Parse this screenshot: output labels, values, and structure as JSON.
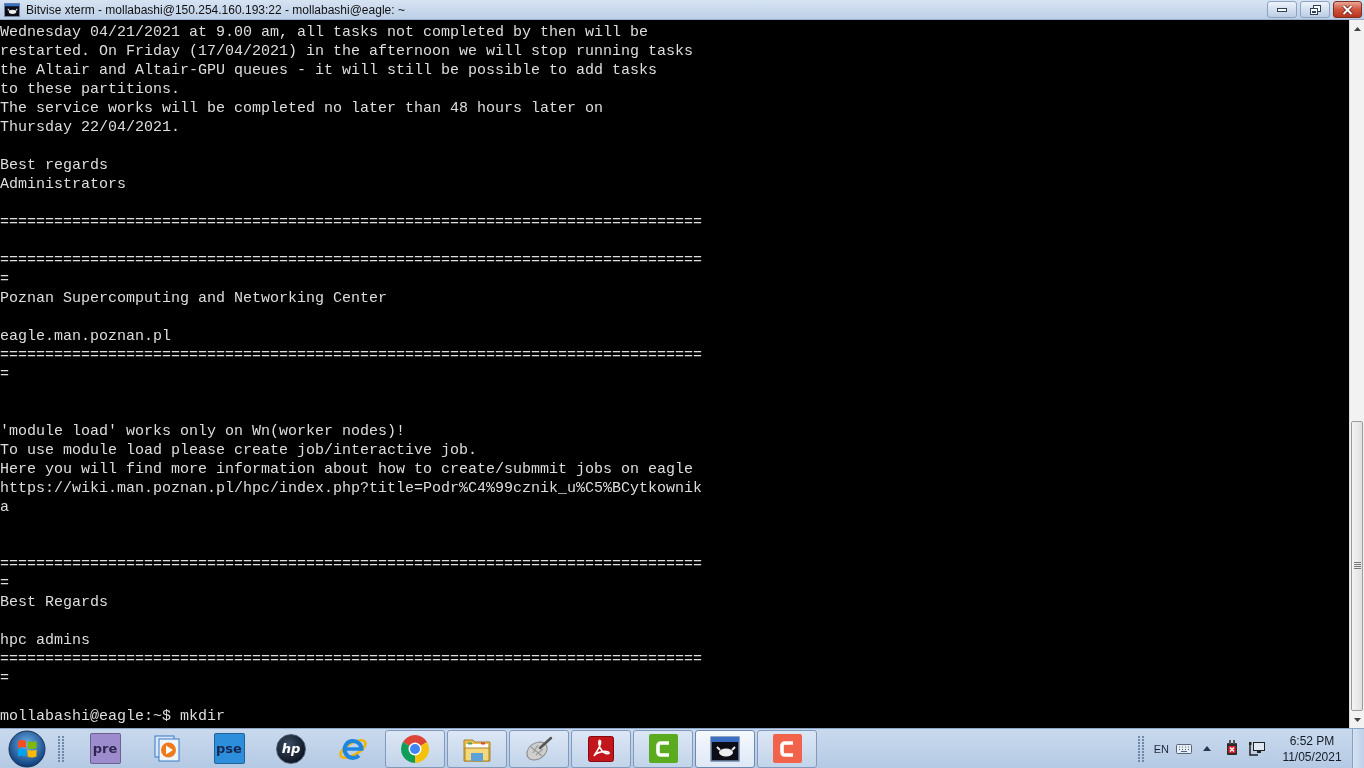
{
  "window": {
    "title": "Bitvise xterm - mollabashi@150.254.160.193:22 - mollabashi@eagle: ~"
  },
  "terminal": {
    "lines": [
      {
        "kind": "text",
        "text": "Wednesday 04/21/2021 at 9.00 am, all tasks not completed by then will be"
      },
      {
        "kind": "text",
        "text": "restarted. On Friday (17/04/2021) in the afternoon we will stop running tasks"
      },
      {
        "kind": "text",
        "text": "the Altair and Altair-GPU queues - it will still be possible to add tasks"
      },
      {
        "kind": "text",
        "text": "to these partitions."
      },
      {
        "kind": "text",
        "text": "The service works will be completed no later than 48 hours later on"
      },
      {
        "kind": "text",
        "text": "Thursday 22/04/2021."
      },
      {
        "kind": "blank"
      },
      {
        "kind": "text",
        "text": "  Best regards"
      },
      {
        "kind": "text",
        "text": "  Administrators"
      },
      {
        "kind": "blank"
      },
      {
        "kind": "text",
        "text": "=============================================================================="
      },
      {
        "kind": "blank"
      },
      {
        "kind": "text",
        "text": "=============================================================================="
      },
      {
        "kind": "text",
        "text": "="
      },
      {
        "kind": "text",
        "text": "                   Poznan Supercomputing and Networking Center"
      },
      {
        "kind": "blank"
      },
      {
        "kind": "text",
        "text": "                               eagle.man.poznan.pl"
      },
      {
        "kind": "text",
        "text": "=============================================================================="
      },
      {
        "kind": "text",
        "text": "="
      },
      {
        "kind": "blank"
      },
      {
        "kind": "blank"
      },
      {
        "kind": "text",
        "text": "                 'module load' works only on Wn(worker nodes)!"
      },
      {
        "kind": "text",
        "text": "             To use module load please create job/interactive job."
      },
      {
        "kind": "text",
        "text": " Here you will find more information about how to create/submmit jobs on eagle"
      },
      {
        "kind": "text",
        "text": "https://wiki.man.poznan.pl/hpc/index.php?title=Podr%C4%99cznik_u%C5%BCytkownik"
      },
      {
        "kind": "text",
        "text": "a"
      },
      {
        "kind": "blank"
      },
      {
        "kind": "blank"
      },
      {
        "kind": "text",
        "text": "=============================================================================="
      },
      {
        "kind": "text",
        "text": "="
      },
      {
        "kind": "text",
        "text": "                                  Best Regards"
      },
      {
        "kind": "blank"
      },
      {
        "kind": "text",
        "text": "                                   hpc admins"
      },
      {
        "kind": "text",
        "text": "=============================================================================="
      },
      {
        "kind": "text",
        "text": "="
      },
      {
        "kind": "blank"
      },
      {
        "kind": "prompt",
        "text": "mollabashi@eagle:~$",
        "command": "mkdir"
      }
    ]
  },
  "taskbar": {
    "apps": [
      {
        "kind": "tile",
        "label": "pre",
        "color": "#9d8ccd",
        "running": false,
        "selected": false
      },
      {
        "kind": "player",
        "running": false,
        "selected": false
      },
      {
        "kind": "tile",
        "label": "pse",
        "color": "#2d8edb",
        "running": false,
        "selected": false
      },
      {
        "kind": "disc",
        "label": "hp",
        "running": false,
        "selected": false
      },
      {
        "kind": "browser_e",
        "running": false,
        "selected": false
      },
      {
        "kind": "segments",
        "running": true,
        "selected": false
      },
      {
        "kind": "folder",
        "running": true,
        "selected": false
      },
      {
        "kind": "dish",
        "running": true,
        "selected": false
      },
      {
        "kind": "swirl",
        "running": true,
        "selected": false
      },
      {
        "kind": "bracket",
        "color": "#5aab1e",
        "running": true,
        "selected": false
      },
      {
        "kind": "terminal",
        "running": true,
        "selected": true
      },
      {
        "kind": "bracket",
        "color": "#f1644b",
        "running": true,
        "selected": false
      }
    ],
    "tray": {
      "language": "EN",
      "time": "6:52 PM",
      "date": "11/05/2021"
    }
  }
}
